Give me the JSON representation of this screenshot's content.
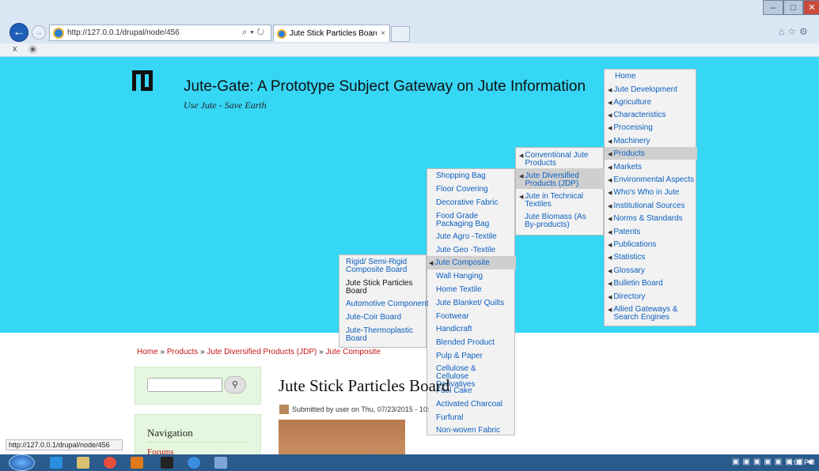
{
  "browser": {
    "url": "http://127.0.0.1/drupal/node/456",
    "tab_title": "Jute Stick Particles Board | J...",
    "tab_close": "×",
    "cmd_close": "x",
    "status_url": "http://127.0.0.1/drupal/node/456"
  },
  "site": {
    "title": "Jute-Gate: A Prototype Subject Gateway on Jute Information",
    "slogan": "Use Jute - Save Earth"
  },
  "menu_main": [
    "Home",
    "Jute Development",
    "Agriculture",
    "Characteristics",
    "Processing",
    "Machinery",
    "Products",
    "Markets",
    "Environmental Aspects",
    "Who's Who in Jute",
    "Institutional Sources",
    "Norms & Standards",
    "Patents",
    "Publications",
    "Statistics",
    "Glossary",
    "Bulletin Board",
    "Directory",
    "Allied Gateways & Search Engines"
  ],
  "menu_products": [
    "Conventional Jute Products",
    "Jute Diversified Products (JDP)",
    "Jute in Technical Textiles",
    "Jute Biomass (As By-products)"
  ],
  "menu_jdp": [
    "Shopping Bag",
    "Floor Covering",
    "Decorative Fabric",
    "Food Grade Packaging Bag",
    "Jute Agro -Textile",
    "Jute Geo -Textile",
    "Jute Composite",
    "Wall Hanging",
    "Home Textile",
    "Jute Blanket/ Quilts",
    "Footwear",
    "Handicraft",
    "Blended Product",
    "Pulp & Paper",
    "Cellulose & Cellulose Derivatives",
    "Fuel Cake",
    "Activated Charcoal",
    "Furfural",
    "Non-woven Fabric"
  ],
  "menu_composite": [
    "Rigid/ Semi-Rigid Composite Board",
    "Jute Stick Particles Board",
    "Automotive Component",
    "Jute-Coir Board",
    "Jute-Thermoplastic Board"
  ],
  "breadcrumb": {
    "items": [
      "Home",
      "Products",
      "Jute Diversified Products (JDP)",
      "Jute Composite"
    ],
    "sep": "»"
  },
  "sidebar": {
    "search_button": "⚲",
    "nav_title": "Navigation",
    "forums": "Forums"
  },
  "node": {
    "title": "Jute Stick Particles Board",
    "submitted": "Submitted by user on Thu, 07/23/2015 - 10:"
  },
  "taskbar": {
    "clock": "4:03 PM"
  },
  "colors": {
    "banner": "#36d6f5",
    "link_blue": "#0c5fbf",
    "link_red": "#c51616",
    "sidebar_bg": "#e5f7de"
  }
}
